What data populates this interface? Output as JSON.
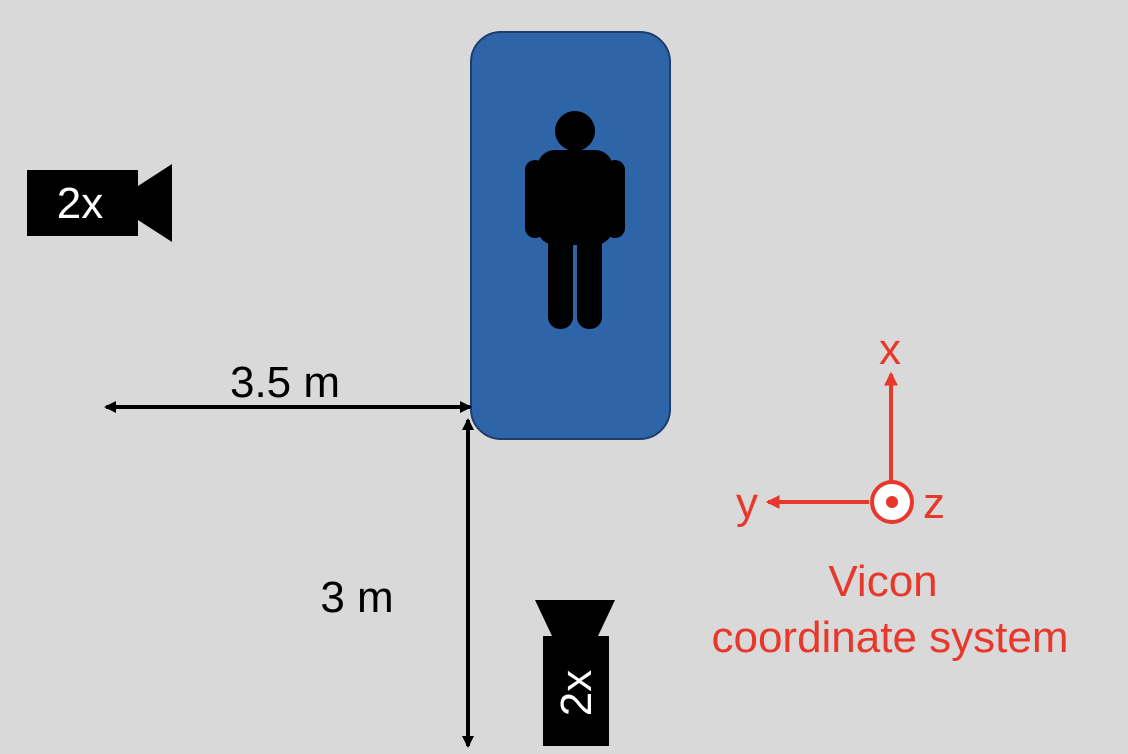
{
  "cameras": {
    "left_count": "2x",
    "bottom_count": "2x",
    "icon": "video-camera-icon"
  },
  "subject": {
    "icon": "person-icon",
    "mat_color": "#2e64a8"
  },
  "dimensions": {
    "horizontal": "3.5 m",
    "vertical": "3 m"
  },
  "axes": {
    "x": "x",
    "y": "y",
    "z": "z",
    "color": "#e8382c"
  },
  "caption": {
    "line1": "Vicon",
    "line2": "coordinate system"
  }
}
